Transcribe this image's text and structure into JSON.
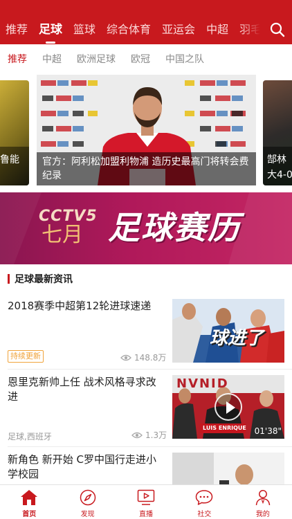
{
  "top_nav": {
    "tabs": [
      "推荐",
      "足球",
      "篮球",
      "综合体育",
      "亚运会",
      "中超",
      "羽毛"
    ],
    "active_index": 1,
    "search_icon": "search-icon"
  },
  "sub_nav": {
    "tabs": [
      "推荐",
      "中超",
      "欧洲足球",
      "欧冠",
      "中国之队"
    ],
    "active_index": 0
  },
  "carousel": {
    "left_caption": "鲁能",
    "main_caption": "官方：阿利松加盟利物浦 造历史最高门将转会费纪录",
    "right_caption": "郜林 大4-0"
  },
  "banner": {
    "logo": "CCTV5",
    "month": "七月",
    "title": "足球赛历"
  },
  "section": {
    "title": "足球最新资讯"
  },
  "news": [
    {
      "title": "2018赛季中超第12轮进球速递",
      "tag": "持续更新",
      "views": "148.8万",
      "thumb_text": "球进了"
    },
    {
      "title": "恩里克新帅上任 战术风格寻求改进",
      "source": "足球,西班牙",
      "views": "1.3万",
      "duration": "01'38\"",
      "thumb_text": "LUIS ENRIQUE",
      "thumb_top_text": "NVNID"
    },
    {
      "title": "新角色 新开始 C罗中国行走进小学校园"
    }
  ],
  "tab_bar": [
    {
      "label": "首页",
      "icon": "home-icon"
    },
    {
      "label": "发现",
      "icon": "compass-icon"
    },
    {
      "label": "直播",
      "icon": "tv-play-icon"
    },
    {
      "label": "社交",
      "icon": "chat-bubble-icon"
    },
    {
      "label": "我的",
      "icon": "user-icon"
    }
  ],
  "colors": {
    "brand_red": "#c8191e",
    "tag_orange": "#f0a33a",
    "banner_magenta": "#b0195a"
  }
}
